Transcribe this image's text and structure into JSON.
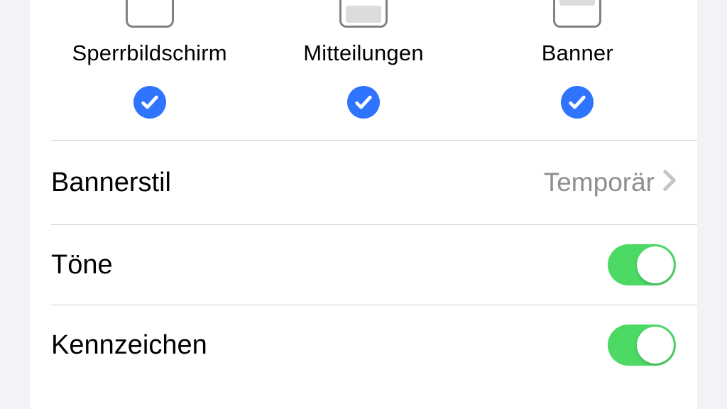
{
  "alerts": {
    "options": [
      {
        "label": "Sperrbildschirm",
        "checked": true
      },
      {
        "label": "Mitteilungen",
        "checked": true
      },
      {
        "label": "Banner",
        "checked": true
      }
    ]
  },
  "rows": {
    "bannerStyle": {
      "label": "Bannerstil",
      "value": "Temporär"
    },
    "sounds": {
      "label": "Töne",
      "on": true
    },
    "badges": {
      "label": "Kennzeichen",
      "on": true
    }
  }
}
